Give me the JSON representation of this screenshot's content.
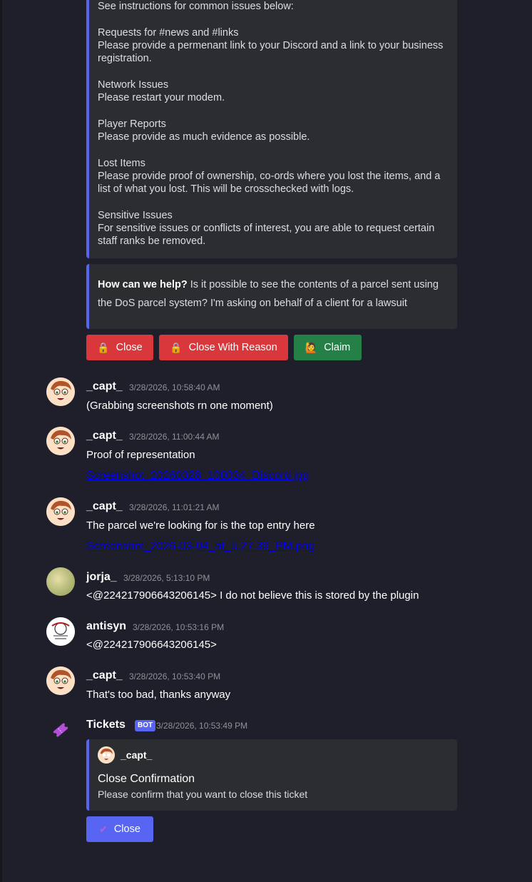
{
  "embed_info": {
    "lines": [
      "See instructions for common issues below:",
      "",
      "Requests for #news and #links",
      "Please provide a permenant link to your Discord and a link to your business",
      "registration.",
      "",
      "Network Issues",
      "Please restart your modem.",
      "",
      "Player Reports",
      "Please provide as much evidence as possible.",
      "",
      "Lost Items",
      "Please provide proof of ownership, co-ords where you lost the items, and a",
      "list of what you lost. This will be crosschecked with logs.",
      "",
      "Sensitive Issues",
      "For sensitive issues or conflicts of interest, you are able to request certain",
      "staff ranks be removed."
    ]
  },
  "embed_help": {
    "question_label": "How can we help?",
    "question_text": " Is it possible to see the contents of a parcel sent using the DoS parcel system?  I'm asking on behalf of a client for a lawsuit"
  },
  "buttons": {
    "close": "Close",
    "close_reason": "Close With Reason",
    "claim": "Claim",
    "confirm_close": "Close"
  },
  "messages": [
    {
      "author": "_capt_",
      "time": "3/28/2026, 10:58:40 AM",
      "text": "(Grabbing screenshots rn one moment)"
    },
    {
      "author": "_capt_",
      "time": "3/28/2026, 11:00:44 AM",
      "text": "Proof of representation",
      "link": "Screenshot_20260328_100034_Discord.jpg"
    },
    {
      "author": "_capt_",
      "time": "3/28/2026, 11:01:21 AM",
      "text": "The parcel we're looking for is the top entry here",
      "link": "Screenshot_2026-03-04_at_5.27.39_PM.png"
    },
    {
      "author": "jorja_",
      "time": "3/28/2026, 5:13:10 PM",
      "text": "<@224217906643206145> I do not believe this is stored by the plugin"
    },
    {
      "author": "antisyn",
      "time": "3/28/2026, 10:53:16 PM",
      "text": "<@224217906643206145>"
    },
    {
      "author": "_capt_",
      "time": "3/28/2026, 10:53:40 PM",
      "text": "That's too bad, thanks anyway"
    },
    {
      "author": "Tickets",
      "badge": "BOT",
      "time": "3/28/2026, 10:53:49 PM"
    }
  ],
  "confirm_embed": {
    "author": "_capt_",
    "title": "Close Confirmation",
    "description": "Please confirm that you want to close this ticket"
  },
  "icons": {
    "lock": "🔒",
    "claim": "🙋",
    "ticket": "ticket-icon",
    "check": "✔"
  },
  "colors": {
    "background": "#1e1f2b",
    "embed_bg": "#2b2d31",
    "embed_accent": "#5865f2",
    "danger": "#da373c",
    "success": "#248046",
    "primary": "#5865f2"
  }
}
